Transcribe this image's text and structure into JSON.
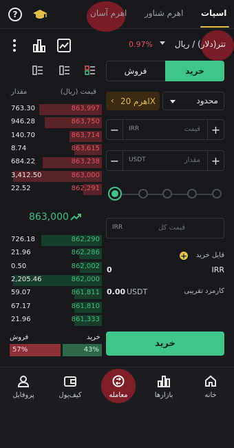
{
  "top_tabs": {
    "spot": "اسپات",
    "floating": "اهرم شناور",
    "easy": "اهرم آسان"
  },
  "pair": {
    "name": "تتر(دلار) / ریال",
    "change": "0.97%"
  },
  "orderbook": {
    "price_header": "قیمت (ریال)",
    "qty_header": "مقدار",
    "asks": [
      {
        "qty": "763.30",
        "price": "863,997",
        "depth": 0.68
      },
      {
        "qty": "946.28",
        "price": "863,750",
        "depth": 0.62
      },
      {
        "qty": "140.70",
        "price": "863,714",
        "depth": 0.35
      },
      {
        "qty": "8.74",
        "price": "863,615",
        "depth": 0.3
      },
      {
        "qty": "684.22",
        "price": "863,238",
        "depth": 0.64
      },
      {
        "qty": "3,412.50",
        "price": "863,000",
        "depth": 0.96
      },
      {
        "qty": "22.52",
        "price": "862,291",
        "depth": 0.2
      }
    ],
    "last_price": "863,000",
    "bids": [
      {
        "qty": "726.18",
        "price": "862,290",
        "depth": 0.66
      },
      {
        "qty": "21.96",
        "price": "862,286",
        "depth": 0.25
      },
      {
        "qty": "0.50",
        "price": "862,002",
        "depth": 0.24
      },
      {
        "qty": "2,205.46",
        "price": "862,000",
        "depth": 0.96
      },
      {
        "qty": "59.07",
        "price": "861,811",
        "depth": 0.3
      },
      {
        "qty": "67.17",
        "price": "861,810",
        "depth": 0.3
      },
      {
        "qty": "21.96",
        "price": "861,333",
        "depth": 0.3
      }
    ],
    "ratio": {
      "sell_label": "فروش",
      "buy_label": "خرید",
      "sell_pct": "57%",
      "buy_pct": "43%"
    }
  },
  "trade": {
    "buy_tab": "خرید",
    "sell_tab": "فروش",
    "leverage": "اهرم 20X",
    "order_type": "محدود",
    "price_unit": "IRR",
    "price_placeholder": "قیمت",
    "amount_unit": "USDT",
    "amount_placeholder": "مقدار",
    "total_unit": "IRR",
    "total_placeholder": "قیمت کل",
    "available_label": "قابل خرید",
    "available_unit": "IRR",
    "available_value": "0",
    "fee_label": "کارمزد تقریبی",
    "fee_value": "0.00",
    "fee_unit": "USDT",
    "submit": "خرید"
  },
  "nav": {
    "home": "خانه",
    "markets": "بازارها",
    "trade": "معامله",
    "wallet": "کیف‌پول",
    "profile": "پروفایل"
  },
  "colors": {
    "buy": "#3fc48a",
    "sell": "#e05561",
    "accent": "#e2c04a"
  }
}
